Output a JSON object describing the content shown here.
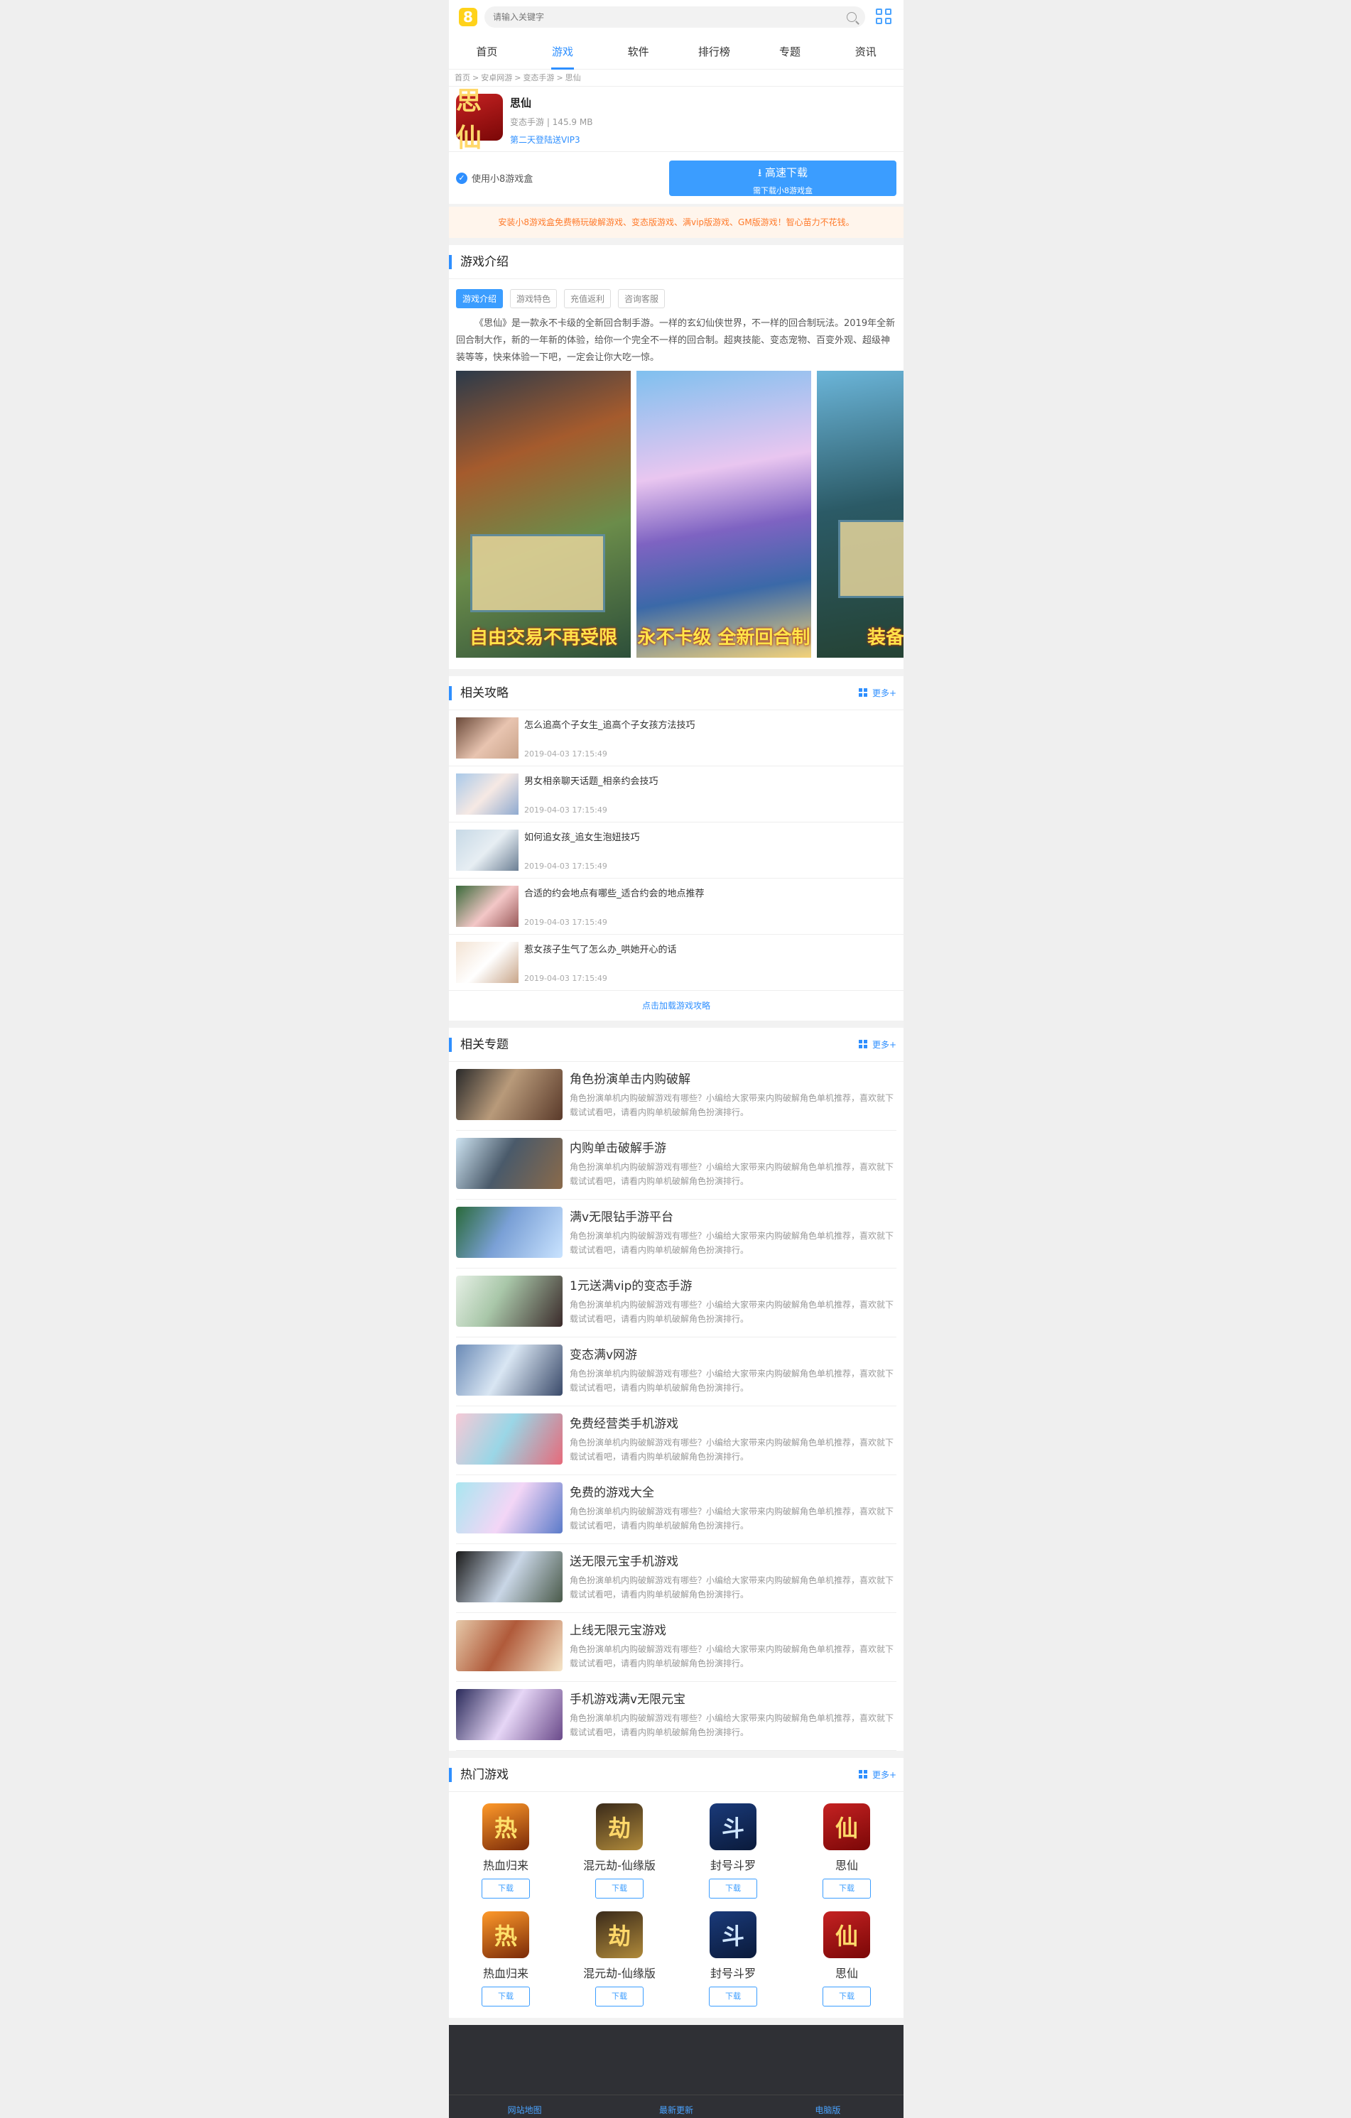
{
  "search": {
    "placeholder": "请输入关键字"
  },
  "logo": "8",
  "nav": [
    "首页",
    "游戏",
    "软件",
    "排行榜",
    "专题",
    "资讯"
  ],
  "nav_active": 1,
  "breadcrumb": [
    "首页",
    "安卓网游",
    "变态手游",
    "思仙"
  ],
  "game": {
    "name": "思仙",
    "icon_text": "思仙",
    "meta": "变态手游 | 145.9 MB",
    "vip": "第二天登陆送VIP3"
  },
  "download": {
    "box_label": "使用小8游戏盒",
    "btn_main": "高速下载",
    "btn_sub": "需下载小8游戏盒"
  },
  "notice": "安装小8游戏盒免费畅玩破解游戏、变态版游戏、满vip版游戏、GM版游戏！智心苗力不花钱。",
  "intro_section": {
    "title": "游戏介绍",
    "tabs": [
      "游戏介绍",
      "游戏特色",
      "充值返利",
      "咨询客服"
    ],
    "text": "《思仙》是一款永不卡级的全新回合制手游。一样的玄幻仙侠世界，不一样的回合制玩法。2019年全新回合制大作，新的一年新的体验，给你一个完全不一样的回合制。超爽技能、变态宠物、百变外观、超级神装等等，快来体验一下吧，一定会让你大吃一惊。",
    "screenshots": [
      "自由交易不再受限",
      "永不卡级 全新回合制",
      "装备全靠"
    ]
  },
  "articles": {
    "title": "相关攻略",
    "more": "更多+",
    "items": [
      {
        "title": "怎么追高个子女生_追高个子女孩方法技巧",
        "date": "2019-04-03 17:15:49"
      },
      {
        "title": "男女相亲聊天话题_相亲约会技巧",
        "date": "2019-04-03 17:15:49"
      },
      {
        "title": "如何追女孩_追女生泡妞技巧",
        "date": "2019-04-03 17:15:49"
      },
      {
        "title": "合适的约会地点有哪些_适合约会的地点推荐",
        "date": "2019-04-03 17:15:49"
      },
      {
        "title": "惹女孩子生气了怎么办_哄她开心的话",
        "date": "2019-04-03 17:15:49"
      }
    ],
    "load_more": "点击加载游戏攻略"
  },
  "topics": {
    "title": "相关专题",
    "more": "更多+",
    "items": [
      {
        "title": "角色扮演单击内购破解",
        "desc": "角色扮演单机内购破解游戏有哪些？小编给大家带来内购破解角色单机推荐，喜欢就下载试试看吧，请看内购单机破解角色扮演排行。"
      },
      {
        "title": "内购单击破解手游",
        "desc": "角色扮演单机内购破解游戏有哪些？小编给大家带来内购破解角色单机推荐，喜欢就下载试试看吧，请看内购单机破解角色扮演排行。"
      },
      {
        "title": "满v无限钻手游平台",
        "desc": "角色扮演单机内购破解游戏有哪些？小编给大家带来内购破解角色单机推荐，喜欢就下载试试看吧，请看内购单机破解角色扮演排行。"
      },
      {
        "title": "1元送满vip的变态手游",
        "desc": "角色扮演单机内购破解游戏有哪些？小编给大家带来内购破解角色单机推荐，喜欢就下载试试看吧，请看内购单机破解角色扮演排行。"
      },
      {
        "title": "变态满v网游",
        "desc": "角色扮演单机内购破解游戏有哪些？小编给大家带来内购破解角色单机推荐，喜欢就下载试试看吧，请看内购单机破解角色扮演排行。"
      },
      {
        "title": "免费经营类手机游戏",
        "desc": "角色扮演单机内购破解游戏有哪些？小编给大家带来内购破解角色单机推荐，喜欢就下载试试看吧，请看内购单机破解角色扮演排行。"
      },
      {
        "title": "免费的游戏大全",
        "desc": "角色扮演单机内购破解游戏有哪些？小编给大家带来内购破解角色单机推荐，喜欢就下载试试看吧，请看内购单机破解角色扮演排行。"
      },
      {
        "title": "送无限元宝手机游戏",
        "desc": "角色扮演单机内购破解游戏有哪些？小编给大家带来内购破解角色单机推荐，喜欢就下载试试看吧，请看内购单机破解角色扮演排行。"
      },
      {
        "title": "上线无限元宝游戏",
        "desc": "角色扮演单机内购破解游戏有哪些？小编给大家带来内购破解角色单机推荐，喜欢就下载试试看吧，请看内购单机破解角色扮演排行。"
      },
      {
        "title": "手机游戏满v无限元宝",
        "desc": "角色扮演单机内购破解游戏有哪些？小编给大家带来内购破解角色单机推荐，喜欢就下载试试看吧，请看内购单机破解角色扮演排行。"
      }
    ]
  },
  "hot": {
    "title": "热门游戏",
    "more": "更多+",
    "download_label": "下载",
    "items": [
      {
        "name": "热血归来",
        "icon_text": "热",
        "colors": [
          "#ff9a2a",
          "#7a2a08"
        ],
        "fg": "#ffe06a"
      },
      {
        "name": "混元劫-仙缘版",
        "icon_text": "劫",
        "colors": [
          "#3a2a1a",
          "#b08a3a"
        ],
        "fg": "#ffd86a"
      },
      {
        "name": "封号斗罗",
        "icon_text": "斗",
        "colors": [
          "#1a3a7a",
          "#0a1a3a"
        ],
        "fg": "#cfe6ff"
      },
      {
        "name": "思仙",
        "icon_text": "仙",
        "colors": [
          "#c52222",
          "#7a0707"
        ],
        "fg": "#ffd86a"
      },
      {
        "name": "热血归来",
        "icon_text": "热",
        "colors": [
          "#ff9a2a",
          "#7a2a08"
        ],
        "fg": "#ffe06a"
      },
      {
        "name": "混元劫-仙缘版",
        "icon_text": "劫",
        "colors": [
          "#3a2a1a",
          "#b08a3a"
        ],
        "fg": "#ffd86a"
      },
      {
        "name": "封号斗罗",
        "icon_text": "斗",
        "colors": [
          "#1a3a7a",
          "#0a1a3a"
        ],
        "fg": "#cfe6ff"
      },
      {
        "name": "思仙",
        "icon_text": "仙",
        "colors": [
          "#c52222",
          "#7a0707"
        ],
        "fg": "#ffd86a"
      }
    ]
  },
  "footer": {
    "links": [
      "网站地图",
      "最新更新",
      "电脑版"
    ]
  },
  "colors": {
    "accent": "#2e8fff",
    "notice": "#ff7b2c",
    "footer_bg": "#2f3035"
  }
}
